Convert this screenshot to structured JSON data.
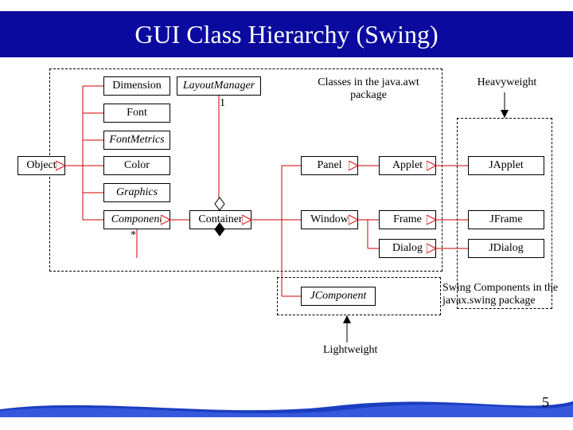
{
  "title": "GUI Class Hierarchy (Swing)",
  "page_number": "5",
  "annotations": {
    "awt_group": "Classes in the java.awt package",
    "heavyweight": "Heavyweight",
    "swing_group": "Swing Components in the javax.swing package",
    "lightweight": "Lightweight",
    "star": "*",
    "one": "1"
  },
  "nodes": {
    "object": "Object",
    "dimension": "Dimension",
    "font": "Font",
    "fontmetrics": "FontMetrics",
    "color": "Color",
    "graphics": "Graphics",
    "component": "Component",
    "layoutmanager": "LayoutManager",
    "container": "Container",
    "panel": "Panel",
    "window": "Window",
    "dialog": "Dialog",
    "applet": "Applet",
    "frame": "Frame",
    "jcomponent": "JComponent",
    "japplet": "JApplet",
    "jframe": "JFrame",
    "jdialog": "JDialog"
  },
  "colors": {
    "title_bg": "#0a0a9e",
    "edge": "#d00000",
    "footer_blue": "#1a3ec0"
  }
}
